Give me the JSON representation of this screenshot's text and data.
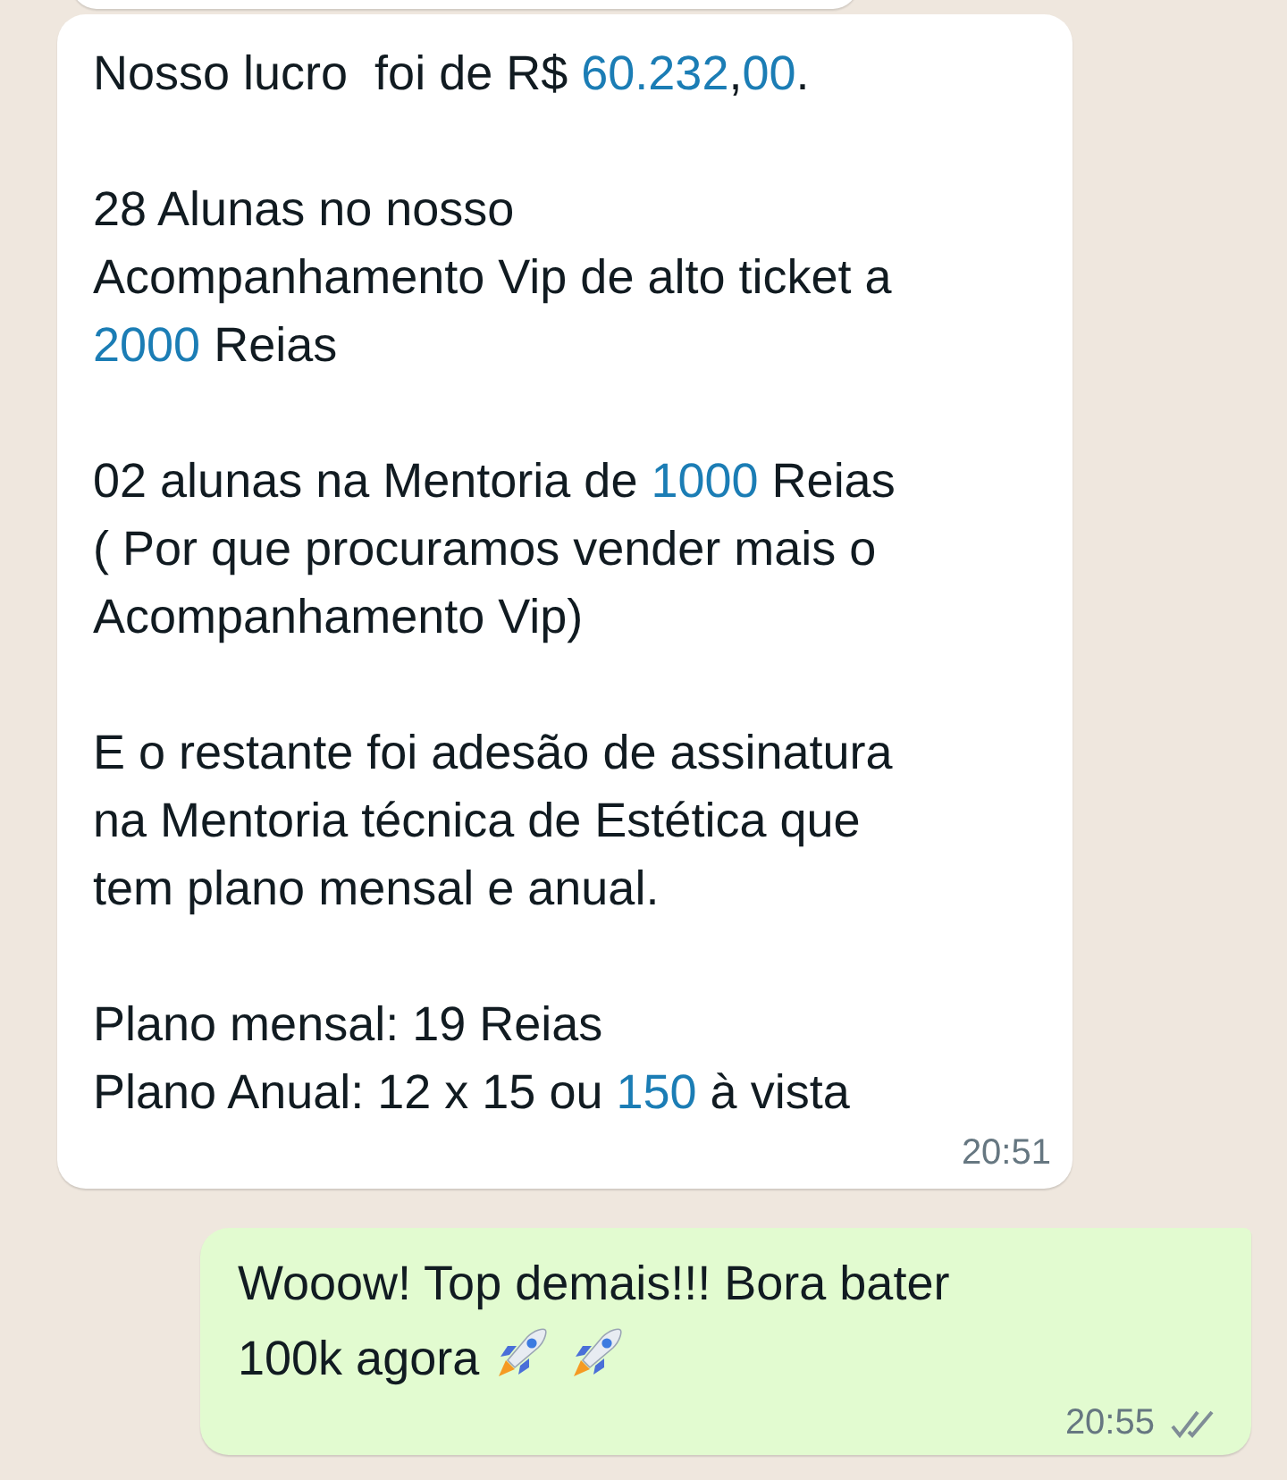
{
  "messages": [
    {
      "outgoing": false,
      "paragraphs": [
        [
          [
            {
              "kind": "text",
              "text": "Nosso lucro  foi de R$ "
            },
            {
              "kind": "number",
              "text": "60.232"
            },
            {
              "kind": "text",
              "text": ","
            },
            {
              "kind": "number",
              "text": "00"
            },
            {
              "kind": "text",
              "text": "."
            }
          ]
        ],
        [
          [
            {
              "kind": "text",
              "text": "28 Alunas no nosso"
            }
          ],
          [
            {
              "kind": "text",
              "text": "Acompanhamento Vip de alto ticket a"
            }
          ],
          [
            {
              "kind": "number",
              "text": "2000"
            },
            {
              "kind": "text",
              "text": " Reias"
            }
          ]
        ],
        [
          [
            {
              "kind": "text",
              "text": "02 alunas na Mentoria de "
            },
            {
              "kind": "number",
              "text": "1000"
            },
            {
              "kind": "text",
              "text": " Reias"
            }
          ],
          [
            {
              "kind": "text",
              "text": "( Por que procuramos vender mais o"
            }
          ],
          [
            {
              "kind": "text",
              "text": "Acompanhamento Vip)"
            }
          ]
        ],
        [
          [
            {
              "kind": "text",
              "text": "E o restante foi adesão de assinatura"
            }
          ],
          [
            {
              "kind": "text",
              "text": "na Mentoria técnica de Estética que"
            }
          ],
          [
            {
              "kind": "text",
              "text": "tem plano mensal e anual."
            }
          ]
        ],
        [
          [
            {
              "kind": "text",
              "text": "Plano mensal: 19 Reias"
            }
          ],
          [
            {
              "kind": "text",
              "text": "Plano Anual: 12 x 15 ou "
            },
            {
              "kind": "number",
              "text": "150"
            },
            {
              "kind": "text",
              "text": " à vista"
            }
          ]
        ]
      ],
      "time": "20:51"
    },
    {
      "outgoing": true,
      "paragraphs": [
        [
          [
            {
              "kind": "text",
              "text": "Wooow! Top demais!!! Bora bater"
            }
          ],
          [
            {
              "kind": "text",
              "text": "100k agora"
            },
            {
              "kind": "rocket"
            },
            {
              "kind": "rocket"
            }
          ]
        ]
      ],
      "time": "20:55",
      "read": false
    }
  ]
}
